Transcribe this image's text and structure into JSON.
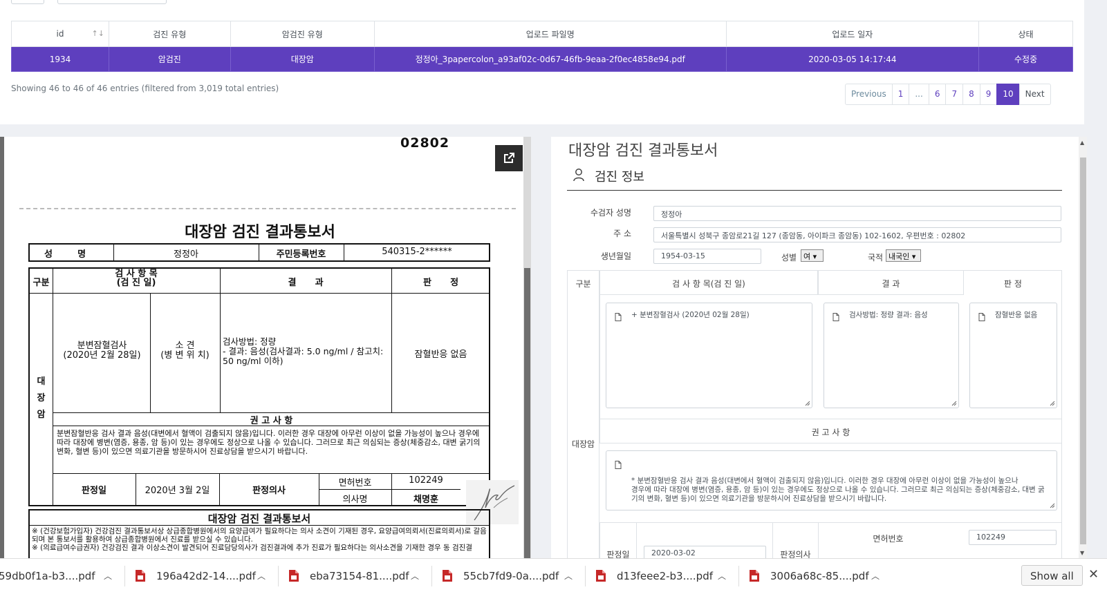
{
  "table": {
    "headers": [
      "id",
      "검진 유형",
      "암검진 유형",
      "업로드 파일명",
      "업로드 일자",
      "상태"
    ],
    "sort_icon": "↑↓",
    "row": {
      "id": "1934",
      "checkup_type": "암검진",
      "cancer_type": "대장암",
      "filename": "정정아_3papercolon_a93af02c-0d67-46fb-9eaa-2f0ec4858e94.pdf",
      "upload_date": "2020-03-05 14:17:44",
      "status": "수정중"
    }
  },
  "entries_info": "Showing 46 to 46 of 46 entries (filtered from 3,019 total entries)",
  "pagination": {
    "previous": "Previous",
    "pages": [
      "1",
      "...",
      "6",
      "7",
      "8",
      "9",
      "10"
    ],
    "active": "10",
    "next": "Next"
  },
  "document": {
    "zip": "02802",
    "title": "대장암 검진 결과통보서",
    "name_label": "성        명",
    "name_value": "정정아",
    "rrn_label": "주민등록번호",
    "rrn_value": "540315-2******",
    "col_category": "구분",
    "col_item": "검 사 항 목\n(검 진 일)",
    "col_result": "결      과",
    "col_verdict": "판      정",
    "category_vertical": "대\n장\n암",
    "test_name": "분변잠혈검사\n(2020년 2월 28일)",
    "finding_label": "소    견\n(병 변 위 치)",
    "result_text": "검사방법: 정량\n - 결과: 음성(검사결과: 5.0 ng/ml / 참고치:\n50 ng/ml 이하)",
    "verdict_text": "잠혈반응 없음",
    "advice_label": "권 고 사 항",
    "advice_text": "분변잠혈반응 검사 결과 음성(대변에서 혈액이 검출되지 않음)입니다. 이러한 경우 대장에 아무런 이상이 없을 가능성이 높으나 경우에 따라 대장에 병변(염증, 용종, 암 등)이 있는 경우에도 정상으로 나올 수 있습니다. 그러므로 최근 의심되는 증상(체중감소, 대변 굵기의 변화, 혈변 등)이 있으면 의료기관을 방문하시어 진료상담을 받으시기 바랍니다.",
    "judgment_date_label": "판정일",
    "judgment_date_value": "2020년 3월 2일",
    "doctor_label": "판정의사",
    "license_label": "면허번호",
    "license_value": "102249",
    "doctor_name_label": "의사명",
    "doctor_name_value": "채명훈",
    "footer_title": "대장암 검진 결과통보서",
    "footer_note_1": "※ (건강보험가입자) 건강검진 결과통보서상 상급종합병원에서의 요양급여가 필요하다는 의사 소견이 기재된 경우, 요양급여의뢰서(진료의뢰서)로 갈음되며 본 통보서를 활용하여 상급종합병원에서 진료를 받으실 수 있습니다.",
    "footer_note_2": "※ (의료급여수급권자) 건강검진 결과 이상소견이 발견되어 진료담당의사가 검진결과에 추가 진료가 필요하다는 의사소견을 기재한 경우 동 검진결"
  },
  "form": {
    "title": "대장암 검진 결과통보서",
    "section_title": "검진 정보",
    "name_label": "수검자 성명",
    "name_value": "정정아",
    "address_label": "주 소",
    "address_value": "서울특별시 성북구 종암로21길 127 (종암동, 아이파크 종암동) 102-1602, 우편번호 : 02802",
    "dob_label": "생년월일",
    "dob_value": "1954-03-15",
    "sex_label": "성별",
    "sex_value": "여",
    "nationality_label": "국적",
    "nationality_value": "내국인",
    "col_category": "구분",
    "col_item": "검 사 항 목(검 진 일)",
    "col_result": "결 과",
    "col_verdict": "판 정",
    "category": "대장암",
    "item_text": "+ 분변잠혈검사 (2020년 02월 28일)",
    "result_text": "검사방법: 정량 결과: 음성",
    "verdict_text": "잠혈반응 없음",
    "advice_label": "권 고 사 항",
    "advice_text": "* 분변잠혈반응 검사 결과 음성(대변에서 혈액이 검출되지 않음)입니다. 이러한 경우 대장에 아무런 이상이 없을 가능성이 높으나\n경우에 따라 대장에 병변(염증, 용종, 암 등)이 있는 경우에도 정상으로 나올 수 있습니다. 그러므로 최근 의심되는 증상(체중감소, 대변 굵기의 변화, 혈변 등)이 있으면 의료기관을 방문하시어 진료상담을 받으시기 바랍니다.",
    "judgment_date_label": "판정일",
    "judgment_date_value": "2020-03-02",
    "doctor_label": "판정의사",
    "license_label": "면허번호",
    "license_value": "102249"
  },
  "downloads": {
    "items": [
      "59db0f1a-b3....pdf",
      "196a42d2-14....pdf",
      "eba73154-81....pdf",
      "55cb7fd9-0a....pdf",
      "d13feee2-b3....pdf",
      "3006a68c-85....pdf"
    ],
    "show_all": "Show all",
    "close": "✕"
  },
  "colors": {
    "accent": "#5e3fbe",
    "pdf_red": "#c62828"
  },
  "icons": {
    "external": "external-link-icon",
    "user": "user-icon",
    "document": "document-icon",
    "pdf": "pdf-file-icon",
    "caret": "chevron-up-icon",
    "close": "close-icon"
  }
}
